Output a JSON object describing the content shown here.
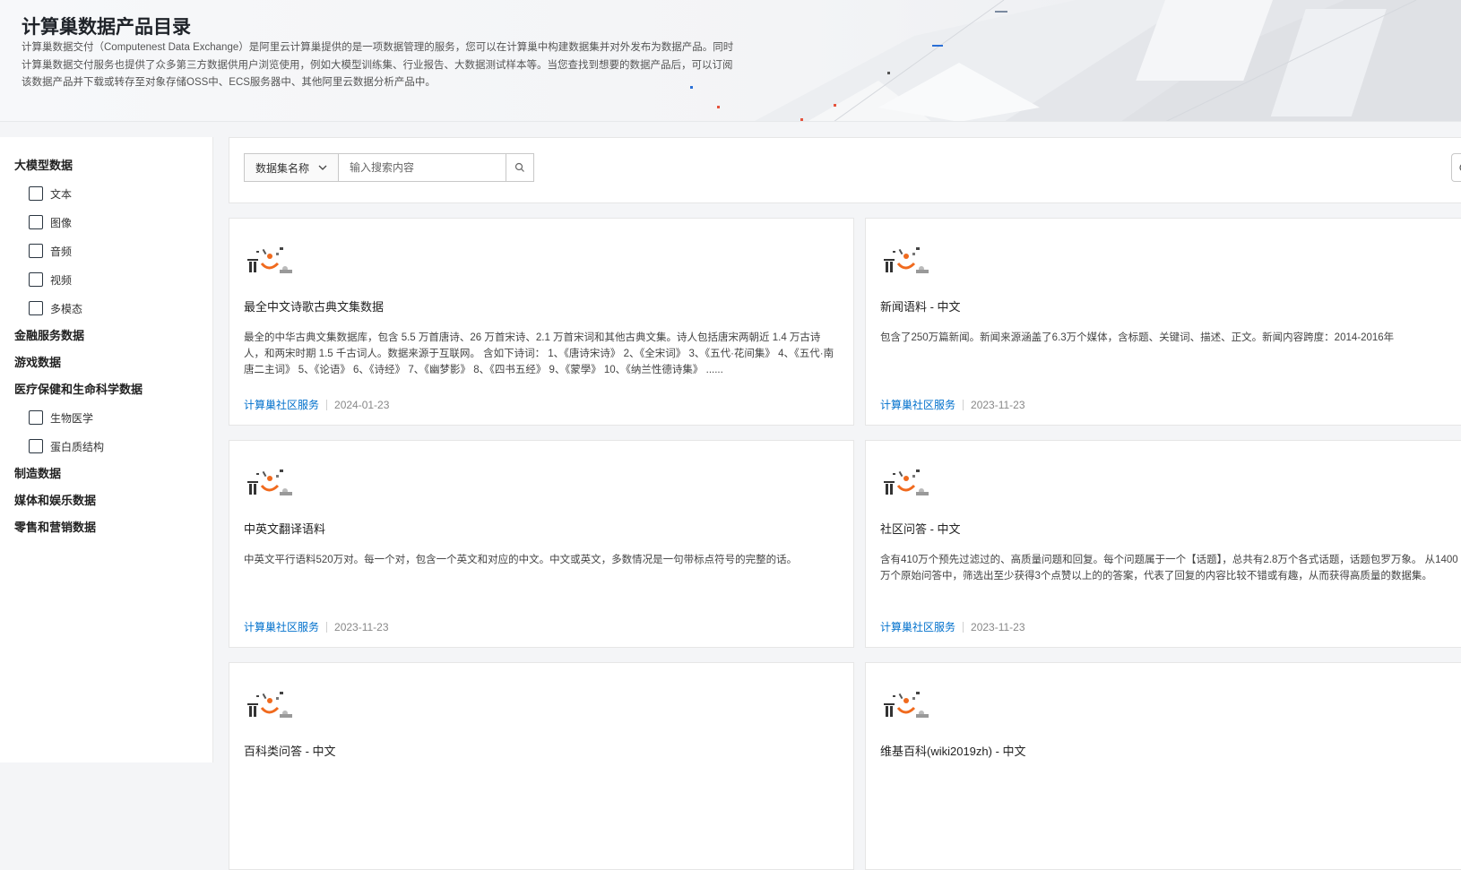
{
  "header": {
    "title": "计算巢数据产品目录",
    "description": "计算巢数据交付（Computenest Data Exchange）是阿里云计算巢提供的是一项数据管理的服务，您可以在计算巢中构建数据集并对外发布为数据产品。同时计算巢数据交付服务也提供了众多第三方数据供用户浏览使用，例如大模型训练集、行业报告、大数据测试样本等。当您查找到想要的数据产品后，可以订阅该数据产品并下载或转存至对象存储OSS中、ECS服务器中、其他阿里云数据分析产品中。"
  },
  "sidebar": {
    "categories": [
      {
        "label": "大模型数据",
        "children": [
          {
            "label": "文本"
          },
          {
            "label": "图像"
          },
          {
            "label": "音频"
          },
          {
            "label": "视频"
          },
          {
            "label": "多模态"
          }
        ]
      },
      {
        "label": "金融服务数据",
        "children": []
      },
      {
        "label": "游戏数据",
        "children": []
      },
      {
        "label": "医疗保健和生命科学数据",
        "children": [
          {
            "label": "生物医学"
          },
          {
            "label": "蛋白质结构"
          }
        ]
      },
      {
        "label": "制造数据",
        "children": []
      },
      {
        "label": "媒体和娱乐数据",
        "children": []
      },
      {
        "label": "零售和营销数据",
        "children": []
      }
    ]
  },
  "search": {
    "field_select": "数据集名称",
    "placeholder": "输入搜索内容"
  },
  "cards": [
    {
      "title": "最全中文诗歌古典文集数据",
      "desc": "最全的中华古典文集数据库，包含 5.5 万首唐诗、26 万首宋诗、2.1 万首宋词和其他古典文集。诗人包括唐宋两朝近 1.4 万古诗人，和两宋时期 1.5 千古词人。数据来源于互联网。 含如下诗词： 1、《唐诗宋诗》 2、《全宋词》 3、《五代·花间集》 4、《五代·南唐二主词》 5、《论语》 6、《诗经》 7、《幽梦影》 8、《四书五经》 9、《蒙學》 10、《纳兰性德诗集》 ......",
      "provider": "计算巢社区服务",
      "date": "2024-01-23"
    },
    {
      "title": "新闻语料 - 中文",
      "desc": "包含了250万篇新闻。新闻来源涵盖了6.3万个媒体，含标题、关键词、描述、正文。新闻内容跨度：2014-2016年",
      "provider": "计算巢社区服务",
      "date": "2023-11-23"
    },
    {
      "title": "中英文翻译语料",
      "desc": "中英文平行语料520万对。每一个对，包含一个英文和对应的中文。中文或英文，多数情况是一句带标点符号的完整的话。",
      "provider": "计算巢社区服务",
      "date": "2023-11-23"
    },
    {
      "title": "社区问答 - 中文",
      "desc": "含有410万个预先过滤过的、高质量问题和回复。每个问题属于一个【话题】，总共有2.8万个各式话题，话题包罗万象。 从1400万个原始问答中，筛选出至少获得3个点赞以上的的答案，代表了回复的内容比较不错或有趣，从而获得高质量的数据集。",
      "provider": "计算巢社区服务",
      "date": "2023-11-23"
    },
    {
      "title": "百科类问答 - 中文",
      "desc": "",
      "provider": "",
      "date": ""
    },
    {
      "title": "维基百科(wiki2019zh) - 中文",
      "desc": "",
      "provider": "",
      "date": ""
    }
  ],
  "colors": {
    "accent": "#0070cc",
    "logo_orange": "#f06a1e"
  }
}
